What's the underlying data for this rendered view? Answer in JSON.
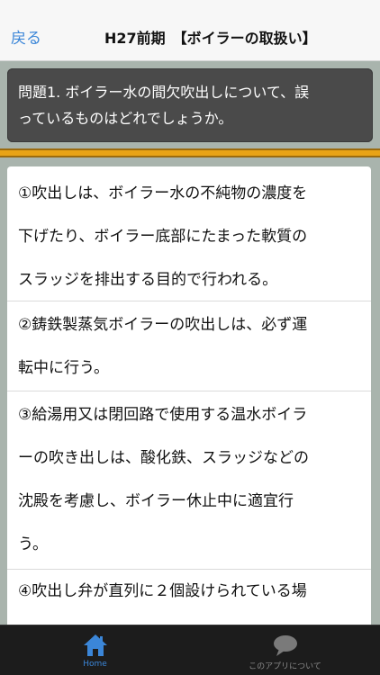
{
  "navbar": {
    "back_label": "戻る",
    "title": "H27前期　【ボイラーの取扱い】"
  },
  "question": {
    "lines": [
      "問題1. ボイラー水の間欠吹出しについて、誤",
      "っているものはどれでしょうか。"
    ]
  },
  "options": [
    {
      "lines": [
        "①吹出しは、ボイラー水の不純物の濃度を",
        "下げたり、ボイラー底部にたまった軟質の",
        "スラッジを排出する目的で行われる。"
      ]
    },
    {
      "lines": [
        "②鋳鉄製蒸気ボイラーの吹出しは、必ず運",
        "転中に行う。"
      ]
    },
    {
      "lines": [
        "③給湯用又は閉回路で使用する温水ボイラ",
        "ーの吹き出しは、酸化鉄、スラッジなどの",
        "沈殿を考慮し、ボイラー休止中に適宜行",
        "う。"
      ]
    },
    {
      "lines": [
        "④吹出し弁が直列に２個設けられている場"
      ]
    }
  ],
  "tabbar": {
    "home_label": "Home",
    "about_label": "このアプリについて",
    "home_icon": "house-icon",
    "about_icon": "speech-bubble-icon",
    "active_color": "#3b86d8"
  }
}
